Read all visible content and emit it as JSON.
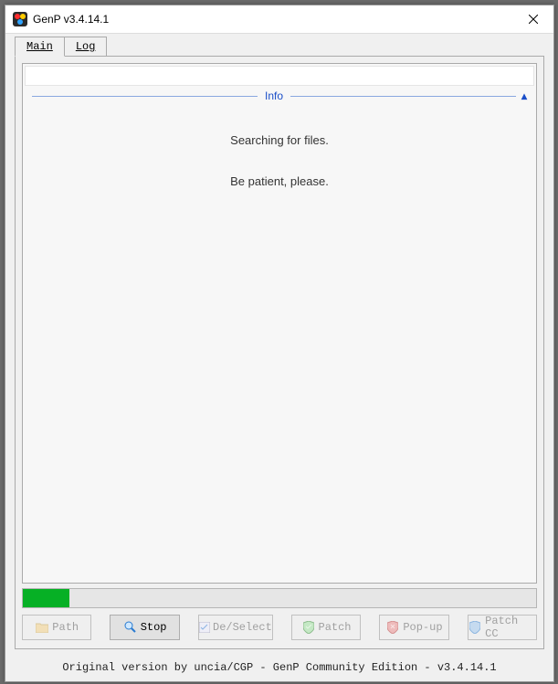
{
  "window": {
    "title": "GenP v3.4.14.1"
  },
  "tabs": {
    "main": "Main",
    "log": "Log"
  },
  "info": {
    "header": "Info",
    "line1": "Searching for files.",
    "line2": "Be patient, please."
  },
  "progress": {
    "percent": 9
  },
  "buttons": {
    "path": {
      "label": "Path",
      "enabled": false
    },
    "stop": {
      "label": "Stop",
      "enabled": true
    },
    "deselect": {
      "label": "De/Select",
      "enabled": false
    },
    "patch": {
      "label": "Patch",
      "enabled": false
    },
    "popup": {
      "label": "Pop-up",
      "enabled": false
    },
    "patchcc": {
      "label": "Patch CC",
      "enabled": false
    }
  },
  "footer": "Original version by uncia/CGP - GenP Community Edition - v3.4.14.1"
}
